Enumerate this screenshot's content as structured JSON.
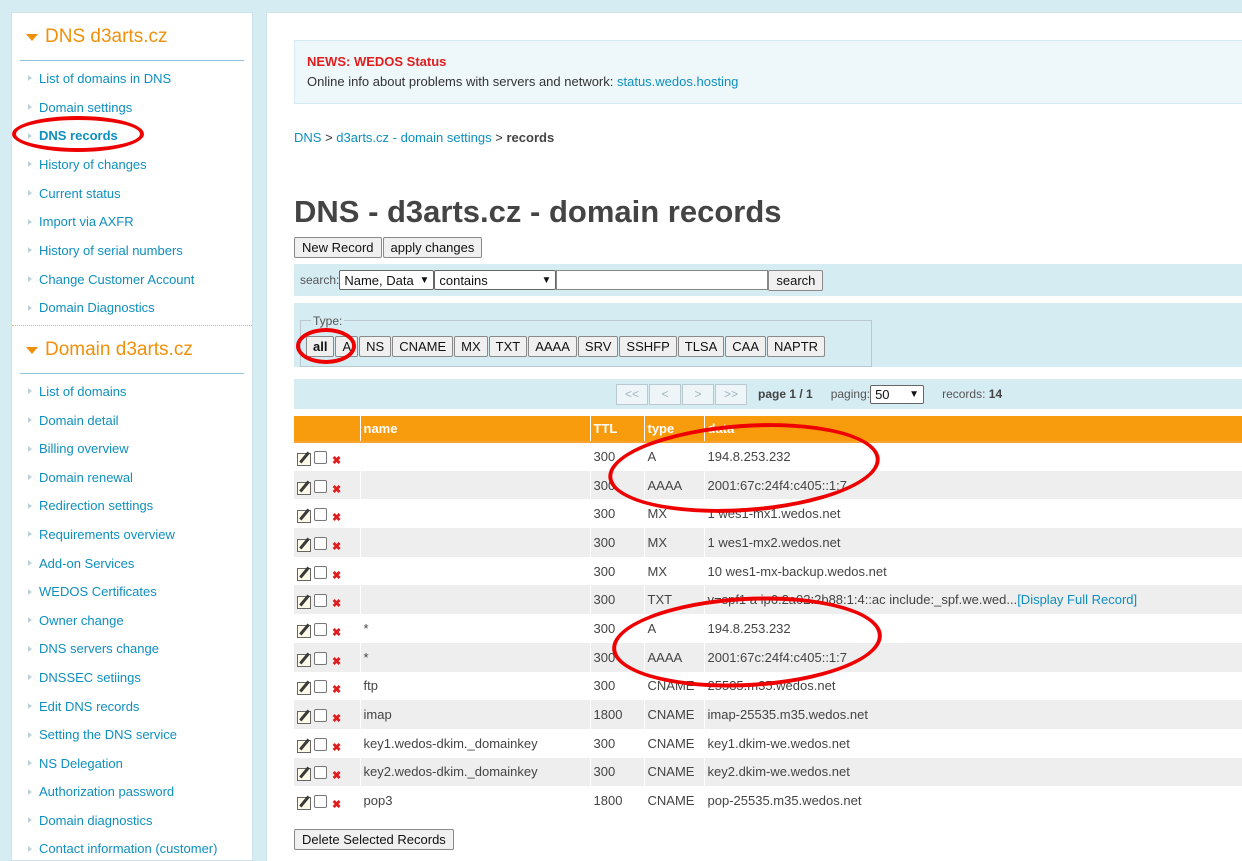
{
  "sidebar": {
    "dns_section": {
      "title": "DNS d3arts.cz",
      "items": [
        {
          "label": "List of domains in DNS"
        },
        {
          "label": "Domain settings"
        },
        {
          "label": "DNS records"
        },
        {
          "label": "History of changes"
        },
        {
          "label": "Current status"
        },
        {
          "label": "Import via AXFR"
        },
        {
          "label": "History of serial numbers"
        },
        {
          "label": "Change Customer Account"
        },
        {
          "label": "Domain Diagnostics"
        }
      ]
    },
    "domain_section": {
      "title": "Domain d3arts.cz",
      "items": [
        {
          "label": "List of domains"
        },
        {
          "label": "Domain detail"
        },
        {
          "label": "Billing overview"
        },
        {
          "label": "Domain renewal"
        },
        {
          "label": "Redirection settings"
        },
        {
          "label": "Requirements overview"
        },
        {
          "label": "Add-on Services"
        },
        {
          "label": "WEDOS Certificates"
        },
        {
          "label": "Owner change"
        },
        {
          "label": "DNS servers change"
        },
        {
          "label": "DNSSEC setiings"
        },
        {
          "label": "Edit DNS records"
        },
        {
          "label": "Setting the DNS service"
        },
        {
          "label": "NS Delegation"
        },
        {
          "label": "Authorization password"
        },
        {
          "label": "Domain diagnostics"
        },
        {
          "label": "Contact information (customer)"
        }
      ]
    }
  },
  "news": {
    "title": "NEWS: WEDOS Status",
    "text": "Online info about problems with servers and network: ",
    "link": "status.wedos.hosting"
  },
  "breadcrumb": {
    "root": "DNS",
    "sep": ">",
    "parent": "d3arts.cz - domain settings",
    "current": "records"
  },
  "page_title": "DNS - d3arts.cz - domain records",
  "toolbar": {
    "new_record": "New Record",
    "apply_changes": "apply changes"
  },
  "search": {
    "label": "search:",
    "field_select": "Name, Data",
    "mode_select": "contains",
    "query": "",
    "button": "search"
  },
  "type_filter": {
    "legend": "Type:",
    "buttons": [
      "all",
      "A",
      "NS",
      "CNAME",
      "MX",
      "TXT",
      "AAAA",
      "SRV",
      "SSHFP",
      "TLSA",
      "CAA",
      "NAPTR"
    ],
    "active": "all"
  },
  "pager": {
    "first": "<<",
    "prev": "<",
    "next": ">",
    "last": ">>",
    "page_label": "page 1 / 1",
    "paging_label": "paging:",
    "paging_value": "50",
    "records_label": "records:",
    "records_count": "14"
  },
  "table": {
    "headers": [
      "",
      "name",
      "TTL",
      "type",
      "data"
    ],
    "rows": [
      {
        "name": "",
        "ttl": "300",
        "type": "A",
        "data": "194.8.253.232",
        "extra": ""
      },
      {
        "name": "",
        "ttl": "300",
        "type": "AAAA",
        "data": "2001:67c:24f4:c405::1:7",
        "extra": ""
      },
      {
        "name": "",
        "ttl": "300",
        "type": "MX",
        "data": "1 wes1-mx1.wedos.net",
        "extra": ""
      },
      {
        "name": "",
        "ttl": "300",
        "type": "MX",
        "data": "1 wes1-mx2.wedos.net",
        "extra": ""
      },
      {
        "name": "",
        "ttl": "300",
        "type": "MX",
        "data": "10 wes1-mx-backup.wedos.net",
        "extra": ""
      },
      {
        "name": "",
        "ttl": "300",
        "type": "TXT",
        "data": "v=spf1 a ip6:2a02:2b88:1:4::ac include:_spf.we.wed...",
        "extra": "[Display Full Record]"
      },
      {
        "name": "*",
        "ttl": "300",
        "type": "A",
        "data": "194.8.253.232",
        "extra": ""
      },
      {
        "name": "*",
        "ttl": "300",
        "type": "AAAA",
        "data": "2001:67c:24f4:c405::1:7",
        "extra": ""
      },
      {
        "name": "ftp",
        "ttl": "300",
        "type": "CNAME",
        "data": "25535.m35.wedos.net",
        "extra": ""
      },
      {
        "name": "imap",
        "ttl": "1800",
        "type": "CNAME",
        "data": "imap-25535.m35.wedos.net",
        "extra": ""
      },
      {
        "name": "key1.wedos-dkim._domainkey",
        "ttl": "300",
        "type": "CNAME",
        "data": "key1.dkim-we.wedos.net",
        "extra": ""
      },
      {
        "name": "key2.wedos-dkim._domainkey",
        "ttl": "300",
        "type": "CNAME",
        "data": "key2.dkim-we.wedos.net",
        "extra": ""
      },
      {
        "name": "pop3",
        "ttl": "1800",
        "type": "CNAME",
        "data": "pop-25535.m35.wedos.net",
        "extra": ""
      }
    ]
  },
  "footer": {
    "delete_selected": "Delete Selected Records"
  },
  "colors": {
    "accent_orange": "#f89c0e",
    "link_blue": "#0e8fbf",
    "annotation_red": "#ee0000",
    "panel_blue": "#d6ecf3"
  }
}
